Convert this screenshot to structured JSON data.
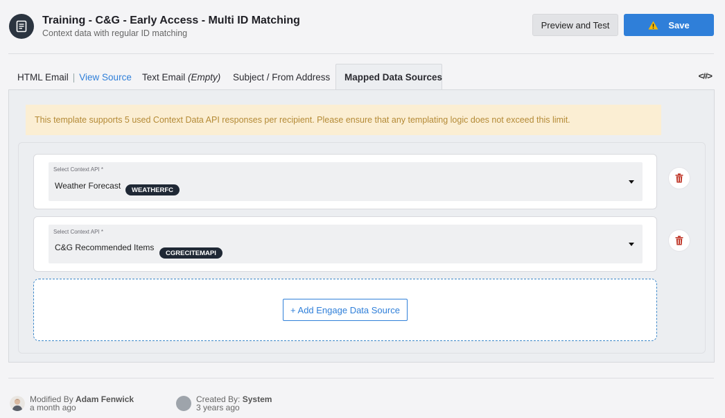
{
  "header": {
    "title": "Training - C&G - Early Access - Multi ID Matching",
    "subtitle": "Context data with regular ID matching",
    "preview_label": "Preview and Test",
    "save_label": "Save"
  },
  "tabs": {
    "html_email": "HTML Email",
    "separator": "|",
    "view_source": "View Source",
    "text_email": "Text Email",
    "text_email_state": "(Empty)",
    "subject": "Subject / From Address",
    "mapped": "Mapped Data Sources"
  },
  "notice": "This template supports 5 used Context Data API responses per recipient. Please ensure that any templating logic does not exceed this limit.",
  "sources": [
    {
      "label": "Select Context API *",
      "value": "Weather Forecast",
      "badge": "WEATHERFC"
    },
    {
      "label": "Select Context API *",
      "value": "C&G Recommended Items",
      "badge": "CGRECITEMAPI"
    }
  ],
  "add_source_label": "+ Add Engage Data Source",
  "footer": {
    "modified_prefix": "Modified By",
    "modified_by": "Adam Fenwick",
    "modified_when": "a month ago",
    "created_prefix": "Created By:",
    "created_by": "System",
    "created_when": "3 years ago"
  },
  "colors": {
    "accent": "#2f7fd9",
    "notice_bg": "#fbeed3",
    "notice_text": "#b48a36",
    "delete": "#c0392b"
  }
}
